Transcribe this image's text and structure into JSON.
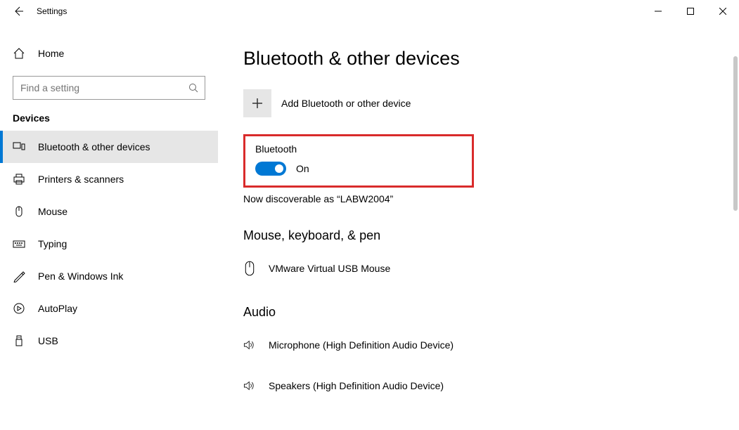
{
  "window": {
    "title": "Settings"
  },
  "sidebar": {
    "home": "Home",
    "search_placeholder": "Find a setting",
    "section": "Devices",
    "items": [
      {
        "label": "Bluetooth & other devices"
      },
      {
        "label": "Printers & scanners"
      },
      {
        "label": "Mouse"
      },
      {
        "label": "Typing"
      },
      {
        "label": "Pen & Windows Ink"
      },
      {
        "label": "AutoPlay"
      },
      {
        "label": "USB"
      }
    ]
  },
  "main": {
    "title": "Bluetooth & other devices",
    "add_label": "Add Bluetooth or other device",
    "bluetooth_header": "Bluetooth",
    "toggle_state": "On",
    "discoverable_text": "Now discoverable as “LABW2004”",
    "section_mouse": "Mouse, keyboard, & pen",
    "device_mouse": "VMware Virtual USB Mouse",
    "section_audio": "Audio",
    "device_mic": "Microphone (High Definition Audio Device)",
    "device_spk": "Speakers (High Definition Audio Device)"
  }
}
